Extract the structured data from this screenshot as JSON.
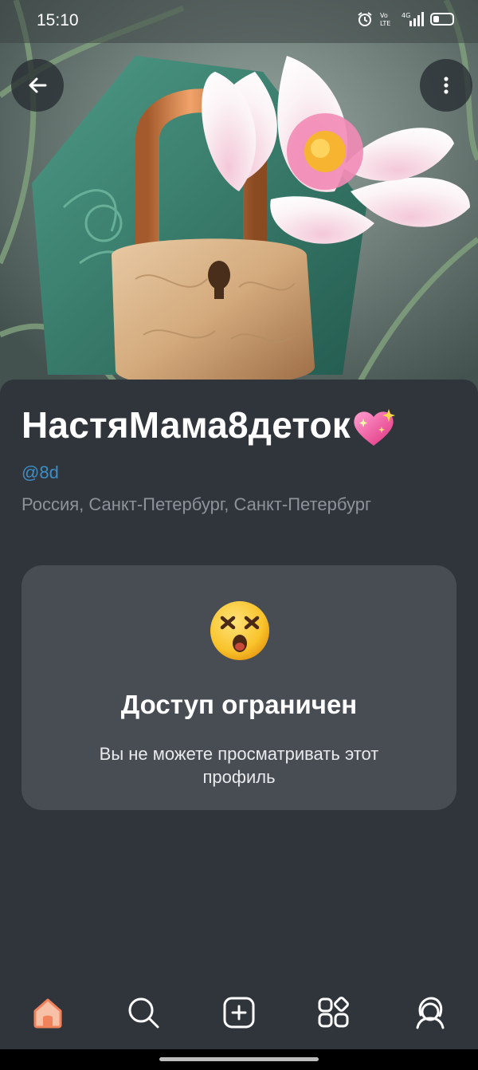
{
  "status_bar": {
    "time": "15:10",
    "network_label": "4G",
    "volte_label": "Vo LTE",
    "icons": [
      "alarm-icon",
      "volte-icon",
      "signal-icon",
      "battery-icon"
    ]
  },
  "cover": {
    "image": "padlock-with-lotus-flower",
    "back_icon": "arrow-left-icon",
    "menu_icon": "more-vertical-icon"
  },
  "profile": {
    "name": "НастяМама8деток",
    "name_emoji": "sparkling-heart-emoji",
    "handle": "@8d",
    "location": "Россия, Санкт-Петербург, Санкт-Петербург"
  },
  "restricted": {
    "emoji": "dizzy-face-emoji",
    "title": "Доступ ограничен",
    "message": "Вы не можете просматривать этот профиль"
  },
  "bottom_nav": {
    "items": [
      {
        "icon": "home-icon",
        "active": true
      },
      {
        "icon": "search-icon",
        "active": false
      },
      {
        "icon": "add-icon",
        "active": false
      },
      {
        "icon": "apps-icon",
        "active": false
      },
      {
        "icon": "profile-icon",
        "active": false
      }
    ]
  },
  "colors": {
    "background": "#30353b",
    "card": "#484d54",
    "handle": "#3c8fc6",
    "location": "#8d939a",
    "active_nav": "#f0835c"
  }
}
